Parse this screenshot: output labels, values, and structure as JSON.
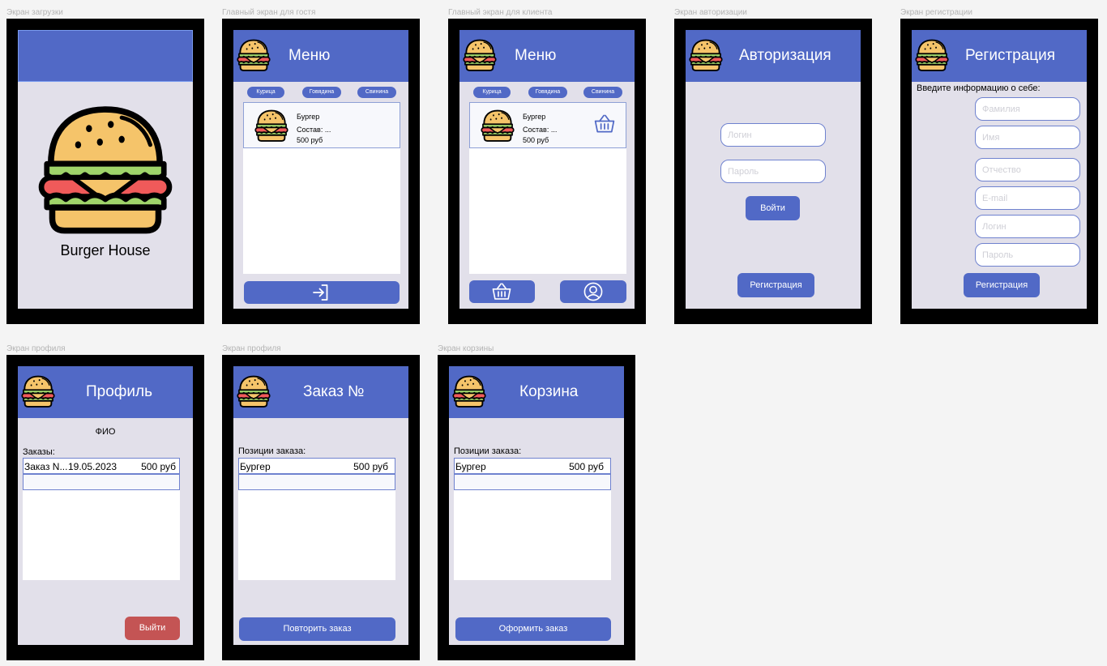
{
  "frames": {
    "loading": "Экран загрузки",
    "guest": "Главный экран для гостя",
    "client": "Главный экран для клиента",
    "auth": "Экран авторизации",
    "register": "Экран регистрации",
    "profile": "Экран профиля",
    "order": "Экран профиля",
    "cart": "Экран корзины"
  },
  "loading": {
    "brand": "Burger House"
  },
  "menu": {
    "title": "Меню",
    "categories": [
      "Курица",
      "Говядина",
      "Свинина"
    ],
    "item": {
      "name": "Бургер",
      "composition": "Состав: ...",
      "price": "500 руб"
    }
  },
  "auth": {
    "title": "Авторизация",
    "login_placeholder": "Логин",
    "password_placeholder": "Пароль",
    "submit": "Войти",
    "register": "Регистрация"
  },
  "register": {
    "title": "Регистрация",
    "prompt": "Введите информацию о себе:",
    "placeholders": [
      "Фамилия",
      "Имя",
      "Отчество",
      "E-mail",
      "Логин",
      "Пароль"
    ],
    "submit": "Регистрация"
  },
  "profile": {
    "title": "Профиль",
    "fio": "ФИО",
    "orders_label": "Заказы:",
    "order_row": {
      "name": "Заказ N...",
      "date": "19.05.2023",
      "price": "500 руб"
    },
    "logout": "Выйти"
  },
  "order": {
    "title": "Заказ №",
    "positions_label": "Позиции заказа:",
    "row": {
      "name": "Бургер",
      "price": "500 руб"
    },
    "repeat": "Повторить заказ"
  },
  "cart": {
    "title": "Корзина",
    "positions_label": "Позиции заказа:",
    "row": {
      "name": "Бургер",
      "price": "500 руб"
    },
    "checkout": "Оформить заказ"
  },
  "icons": [
    "burger-logo-icon",
    "login-arrow-icon",
    "basket-icon",
    "user-icon"
  ],
  "colors": {
    "primary": "#5169c6",
    "screen": "#e2e0ea",
    "danger": "#c45454",
    "device": "#000000"
  }
}
